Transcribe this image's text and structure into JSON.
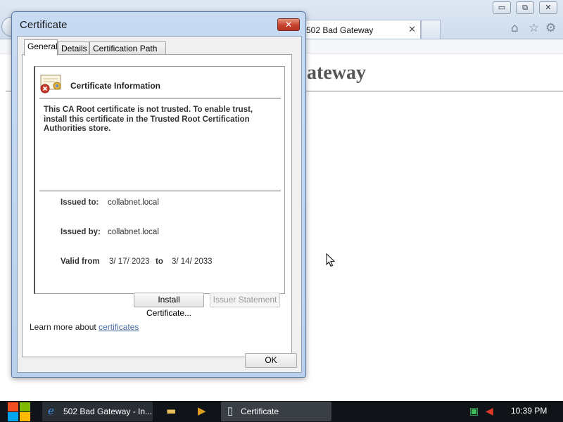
{
  "browser": {
    "tab_title": "502 Bad Gateway",
    "tab_close_glyph": "✕",
    "page_heading_visible": "ateway",
    "window_buttons": [
      "▭",
      "⧉",
      "✕"
    ],
    "toolbar_icons": [
      "home-icon",
      "star-icon",
      "gear-icon"
    ]
  },
  "dialog": {
    "title": "Certificate",
    "close_glyph": "✕",
    "tabs": [
      {
        "label": "General",
        "active": true
      },
      {
        "label": "Details",
        "active": false
      },
      {
        "label": "Certification Path",
        "active": false
      }
    ],
    "info_title": "Certificate Information",
    "message": "This CA Root certificate is not trusted. To enable trust, install this certificate in the Trusted Root Certification Authorities store.",
    "issued_to_label": "Issued to:",
    "issued_to_value": "collabnet.local",
    "issued_by_label": "Issued by:",
    "issued_by_value": "collabnet.local",
    "valid_from_label": "Valid from",
    "valid_from_value": "3/ 17/ 2023",
    "valid_to_label": "to",
    "valid_to_value": "3/ 14/ 2033",
    "install_button": "Install Certificate...",
    "issuer_statement_button": "Issuer Statement",
    "learn_more_prefix": "Learn more about",
    "learn_more_link": "certificates",
    "ok_button": "OK"
  },
  "taskbar": {
    "ie_item": "502 Bad Gateway - In...",
    "cert_item": "Certificate",
    "clock": "10:39 PM"
  },
  "colors": {
    "dialog_frame": "#c7dbf3",
    "close_red": "#c5432d",
    "taskbar": "#101418",
    "link": "#4a6ea0"
  }
}
